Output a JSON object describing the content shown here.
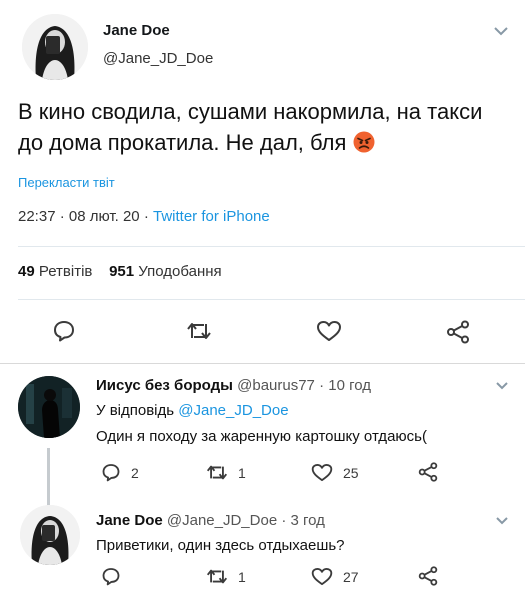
{
  "main_tweet": {
    "author_name": "Jane Doe",
    "handle": "@Jane_JD_Doe",
    "text": "В кино сводила, сушами накормила, на такси до дома прокатила. Не дал, бля",
    "translate_label": "Перекласти твіт",
    "time": "22:37",
    "date": "08 лют. 20",
    "separator": "·",
    "source": "Twitter for iPhone",
    "retweets_count": "49",
    "retweets_label": "Ретвітів",
    "likes_count": "951",
    "likes_label": "Уподобання"
  },
  "replies": [
    {
      "author_name": "Иисус без бороды",
      "handle": "@baurus77",
      "time": "10 год",
      "reply_to_label": "У відповідь",
      "reply_to_handle": "@Jane_JD_Doe",
      "text": "Один я походу за жаренную картошку отдаюсь(",
      "replies_count": "2",
      "retweets_count": "1",
      "likes_count": "25"
    },
    {
      "author_name": "Jane Doe",
      "handle": "@Jane_JD_Doe",
      "time": "3 год",
      "text": "Приветики, один здесь отдыхаешь?",
      "replies_count": "",
      "retweets_count": "1",
      "likes_count": "27"
    }
  ],
  "icons": {
    "reply": "reply-icon",
    "retweet": "retweet-icon",
    "like": "heart-icon",
    "share": "share-icon",
    "menu": "chevron-down-icon",
    "emoji": "angry-face-emoji"
  },
  "colors": {
    "link": "#1b95e0",
    "divider": "#e1e8ed",
    "icon": "#3b3b3b"
  }
}
